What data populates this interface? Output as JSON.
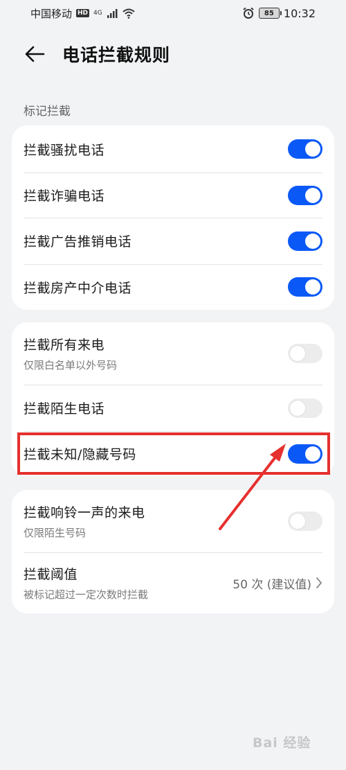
{
  "status_bar": {
    "carrier": "中国移动",
    "hd": "HD",
    "network": "4G",
    "battery": "85",
    "time": "10:32"
  },
  "header": {
    "title": "电话拦截规则"
  },
  "section_label": "标记拦截",
  "card1": {
    "rows": [
      {
        "title": "拦截骚扰电话",
        "toggle": "on"
      },
      {
        "title": "拦截诈骗电话",
        "toggle": "on"
      },
      {
        "title": "拦截广告推销电话",
        "toggle": "on"
      },
      {
        "title": "拦截房产中介电话",
        "toggle": "on"
      }
    ]
  },
  "card2": {
    "rows": [
      {
        "title": "拦截所有来电",
        "subtitle": "仅限白名单以外号码",
        "toggle": "off"
      },
      {
        "title": "拦截陌生电话",
        "toggle": "off"
      },
      {
        "title": "拦截未知/隐藏号码",
        "toggle": "on"
      }
    ]
  },
  "card3": {
    "rows": [
      {
        "title": "拦截响铃一声的来电",
        "subtitle": "仅限陌生号码",
        "toggle": "off"
      },
      {
        "title": "拦截阈值",
        "subtitle": "被标记超过一定次数时拦截",
        "value": "50 次 (建议值)"
      }
    ]
  },
  "watermark": "Bai 经验",
  "colors": {
    "accent": "#0a59f7",
    "highlight": "#e5302e",
    "background": "#f1f3f5"
  }
}
